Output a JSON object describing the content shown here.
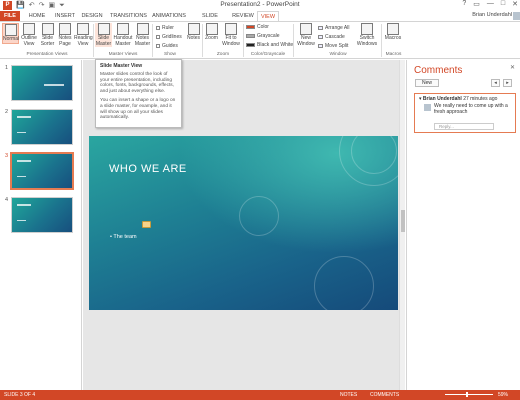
{
  "window": {
    "title": "Presentation2 - PowerPoint",
    "controls": [
      "?",
      "▭",
      "—",
      "□",
      "✕"
    ]
  },
  "qat": [
    "P",
    "💾",
    "↶",
    "↷",
    "▣",
    "⏷"
  ],
  "tabs": [
    "FILE",
    "HOME",
    "INSERT",
    "DESIGN",
    "TRANSITIONS",
    "ANIMATIONS",
    "SLIDE SHOW",
    "REVIEW",
    "VIEW"
  ],
  "active_tab": "VIEW",
  "user": "Brian Underdahl",
  "ribbon": {
    "presentation_views": {
      "buttons": [
        "Normal",
        "Outline View",
        "Slide Sorter",
        "Notes Page",
        "Reading View"
      ],
      "label": "Presentation Views"
    },
    "master_views": {
      "buttons": [
        "Slide Master",
        "Handout Master",
        "Notes Master"
      ],
      "label": "Master Views"
    },
    "show": {
      "items": [
        "Ruler",
        "Gridlines",
        "Guides"
      ],
      "label": "Show"
    },
    "notes": "Notes",
    "zoom": {
      "buttons": [
        "Zoom",
        "Fit to Window"
      ],
      "label": "Zoom"
    },
    "color": {
      "items": [
        "Color",
        "Grayscale",
        "Black and White"
      ],
      "label": "Color/Grayscale"
    },
    "window": {
      "new_window": "New Window",
      "items": [
        "Arrange All",
        "Cascade",
        "Move Split"
      ],
      "switch": "Switch Windows",
      "label": "Window"
    },
    "macros": {
      "button": "Macros",
      "label": "Macros"
    }
  },
  "tooltip": {
    "title": "Slide Master View",
    "body1": "Master slides control the look of your entire presentation, including colors, fonts, backgrounds, effects, and just about everything else.",
    "body2": "You can insert a shape or a logo on a slide master, for example, and it will show up on all your slides automatically."
  },
  "thumbnails": [
    "1",
    "2",
    "3",
    "4"
  ],
  "slide": {
    "title": "WHO WE ARE",
    "bullet": "• The team"
  },
  "comments": {
    "title": "Comments",
    "new": "New",
    "author": "Brian Underdahl",
    "time": "27 minutes ago",
    "text": "We really need to come up with a fresh approach",
    "reply_placeholder": "Reply..."
  },
  "status": {
    "slide": "SLIDE 3 OF 4",
    "notes": "NOTES",
    "comments": "COMMENTS",
    "zoom": "59%"
  }
}
